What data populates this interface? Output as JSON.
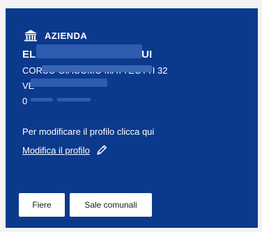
{
  "company_card": {
    "header_label": "AZIENDA",
    "icon": "bank-icon",
    "name_prefix": "EL",
    "name_suffix": "UI",
    "address_visible": "CORSO GIACOMO MATTEOTTI 32",
    "city_prefix": "VE",
    "phone_prefix": "0",
    "edit_hint": "Per modificare il profilo clicca qui",
    "edit_link": "Modifica il profilo",
    "edit_icon": "pencil-icon"
  },
  "buttons": {
    "fiere": "Fiere",
    "sale": "Sale comunali"
  },
  "colors": {
    "card_bg": "#0b3a8c",
    "text": "#ffffff",
    "button_bg": "#ffffff"
  }
}
